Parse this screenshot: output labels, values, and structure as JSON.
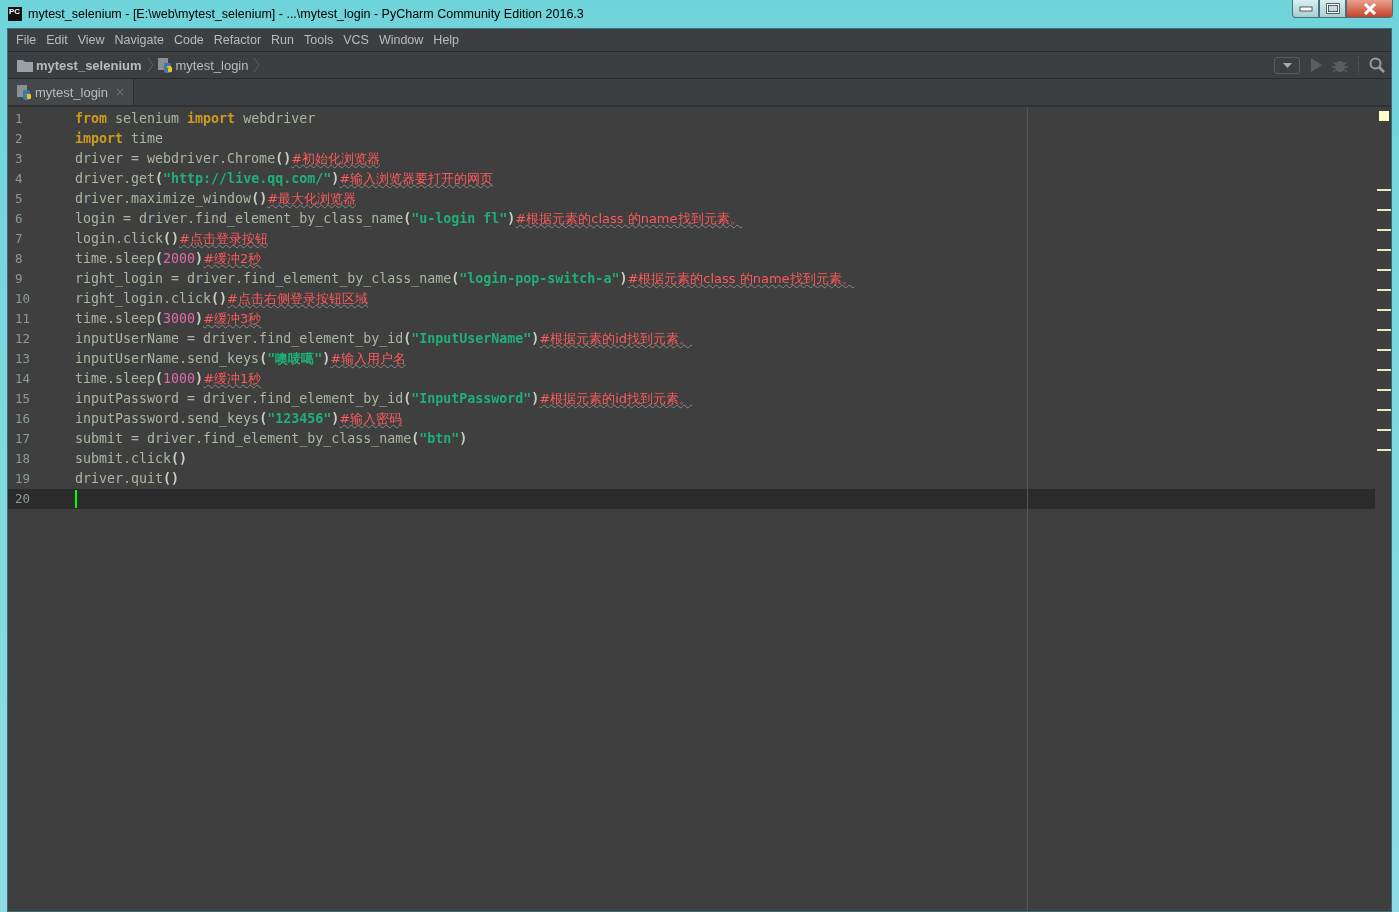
{
  "window": {
    "app_logo": "PC",
    "title": "mytest_selenium - [E:\\web\\mytest_selenium] - ...\\mytest_login - PyCharm Community Edition 2016.3"
  },
  "menu": [
    "File",
    "Edit",
    "View",
    "Navigate",
    "Code",
    "Refactor",
    "Run",
    "Tools",
    "VCS",
    "Window",
    "Help"
  ],
  "breadcrumbs": [
    {
      "kind": "folder",
      "label": "mytest_selenium"
    },
    {
      "kind": "file",
      "label": "mytest_login"
    }
  ],
  "tabs": [
    {
      "label": "mytest_login",
      "close": "×",
      "selected": true
    }
  ],
  "editor": {
    "lines": [
      {
        "number": "1",
        "current": false,
        "tokens": [
          {
            "kind": "keyword",
            "text": "from"
          },
          {
            "kind": "name",
            "text": " selenium "
          },
          {
            "kind": "keyword",
            "text": "import"
          },
          {
            "kind": "name",
            "text": " webdriver"
          }
        ]
      },
      {
        "number": "2",
        "current": false,
        "tokens": [
          {
            "kind": "keyword",
            "text": "import"
          },
          {
            "kind": "name",
            "text": " time"
          }
        ]
      },
      {
        "number": "3",
        "current": false,
        "tokens": [
          {
            "kind": "name",
            "text": "driver = webdriver.Chrome"
          },
          {
            "kind": "bracket",
            "text": "()"
          },
          {
            "kind": "comment",
            "text": "#初始化浏览器"
          }
        ]
      },
      {
        "number": "4",
        "current": false,
        "tokens": [
          {
            "kind": "name",
            "text": "driver.get"
          },
          {
            "kind": "bracket",
            "text": "("
          },
          {
            "kind": "string",
            "text": "\"http://live.qq.com/\""
          },
          {
            "kind": "bracket",
            "text": ")"
          },
          {
            "kind": "comment",
            "text": "#输入浏览器要打开的网页"
          }
        ]
      },
      {
        "number": "5",
        "current": false,
        "tokens": [
          {
            "kind": "name",
            "text": "driver.maximize_window"
          },
          {
            "kind": "bracket",
            "text": "()"
          },
          {
            "kind": "comment",
            "text": "#最大化浏览器"
          }
        ]
      },
      {
        "number": "6",
        "current": false,
        "tokens": [
          {
            "kind": "name",
            "text": "login = driver.find_element_by_class_name"
          },
          {
            "kind": "bracket",
            "text": "("
          },
          {
            "kind": "string",
            "text": "\"u-login fl\""
          },
          {
            "kind": "bracket",
            "text": ")"
          },
          {
            "kind": "comment",
            "text": "#根据元素的class 的name找到元素。"
          }
        ]
      },
      {
        "number": "7",
        "current": false,
        "tokens": [
          {
            "kind": "name",
            "text": "login.click"
          },
          {
            "kind": "bracket",
            "text": "()"
          },
          {
            "kind": "comment",
            "text": "#点击登录按钮"
          }
        ]
      },
      {
        "number": "8",
        "current": false,
        "tokens": [
          {
            "kind": "name",
            "text": "time.sleep"
          },
          {
            "kind": "bracket",
            "text": "("
          },
          {
            "kind": "number",
            "text": "2000"
          },
          {
            "kind": "bracket",
            "text": ")"
          },
          {
            "kind": "comment",
            "text": "#缓冲2秒"
          }
        ]
      },
      {
        "number": "9",
        "current": false,
        "tokens": [
          {
            "kind": "name",
            "text": "right_login = driver.find_element_by_class_name"
          },
          {
            "kind": "bracket",
            "text": "("
          },
          {
            "kind": "string",
            "text": "\"login-pop-switch-a\""
          },
          {
            "kind": "bracket",
            "text": ")"
          },
          {
            "kind": "comment",
            "text": "#根据元素的class 的name找到元素。"
          }
        ]
      },
      {
        "number": "10",
        "current": false,
        "tokens": [
          {
            "kind": "name",
            "text": "right_login.click"
          },
          {
            "kind": "bracket",
            "text": "()"
          },
          {
            "kind": "comment",
            "text": "#点击右侧登录按钮区域"
          }
        ]
      },
      {
        "number": "11",
        "current": false,
        "tokens": [
          {
            "kind": "name",
            "text": "time.sleep"
          },
          {
            "kind": "bracket",
            "text": "("
          },
          {
            "kind": "number",
            "text": "3000"
          },
          {
            "kind": "bracket",
            "text": ")"
          },
          {
            "kind": "comment",
            "text": "#缓冲3秒"
          }
        ]
      },
      {
        "number": "12",
        "current": false,
        "tokens": [
          {
            "kind": "name",
            "text": "inputUserName = driver.find_element_by_id"
          },
          {
            "kind": "bracket",
            "text": "("
          },
          {
            "kind": "string",
            "text": "\"InputUserName\""
          },
          {
            "kind": "bracket",
            "text": ")"
          },
          {
            "kind": "comment",
            "text": "#根据元素的id找到元素。"
          }
        ]
      },
      {
        "number": "13",
        "current": false,
        "tokens": [
          {
            "kind": "name",
            "text": "inputUserName.send_keys"
          },
          {
            "kind": "bracket",
            "text": "("
          },
          {
            "kind": "string",
            "text": "\"噢唛噶\""
          },
          {
            "kind": "bracket",
            "text": ")"
          },
          {
            "kind": "comment",
            "text": "#输入用户名"
          }
        ]
      },
      {
        "number": "14",
        "current": false,
        "tokens": [
          {
            "kind": "name",
            "text": "time.sleep"
          },
          {
            "kind": "bracket",
            "text": "("
          },
          {
            "kind": "number",
            "text": "1000"
          },
          {
            "kind": "bracket",
            "text": ")"
          },
          {
            "kind": "comment",
            "text": "#缓冲1秒"
          }
        ]
      },
      {
        "number": "15",
        "current": false,
        "tokens": [
          {
            "kind": "name",
            "text": "inputPassword = driver.find_element_by_id"
          },
          {
            "kind": "bracket",
            "text": "("
          },
          {
            "kind": "string",
            "text": "\"InputPassword\""
          },
          {
            "kind": "bracket",
            "text": ")"
          },
          {
            "kind": "comment",
            "text": "#根据元素的id找到元素。"
          }
        ]
      },
      {
        "number": "16",
        "current": false,
        "tokens": [
          {
            "kind": "name",
            "text": "inputPassword.send_keys"
          },
          {
            "kind": "bracket",
            "text": "("
          },
          {
            "kind": "string",
            "text": "\"123456\""
          },
          {
            "kind": "bracket",
            "text": ")"
          },
          {
            "kind": "comment",
            "text": "#输入密码"
          }
        ]
      },
      {
        "number": "17",
        "current": false,
        "tokens": [
          {
            "kind": "name",
            "text": "submit = driver.find_element_by_class_name"
          },
          {
            "kind": "bracket",
            "text": "("
          },
          {
            "kind": "string",
            "text": "\"btn\""
          },
          {
            "kind": "bracket",
            "text": ")"
          }
        ]
      },
      {
        "number": "18",
        "current": false,
        "tokens": [
          {
            "kind": "name",
            "text": "submit.click"
          },
          {
            "kind": "bracket",
            "text": "()"
          }
        ]
      },
      {
        "number": "19",
        "current": false,
        "tokens": [
          {
            "kind": "name",
            "text": "driver.quit"
          },
          {
            "kind": "bracket",
            "text": "()"
          }
        ]
      },
      {
        "number": "20",
        "current": true
      }
    ]
  }
}
